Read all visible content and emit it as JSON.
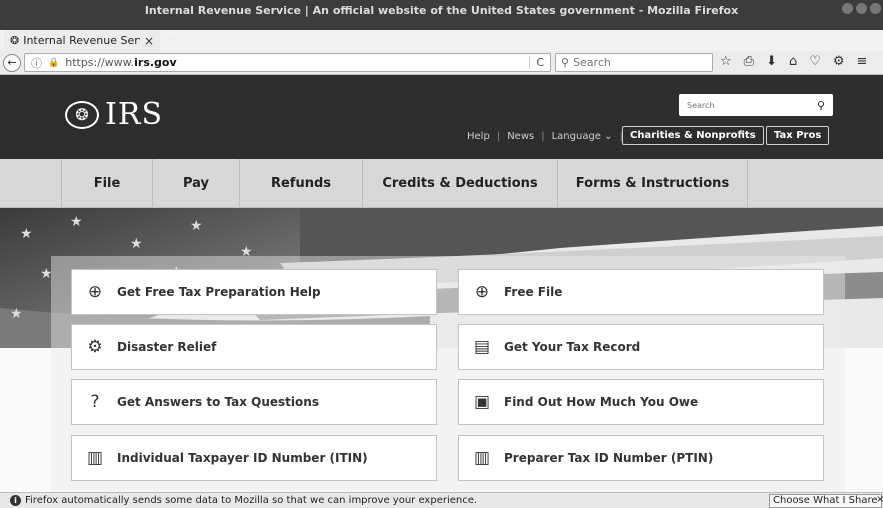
{
  "window": {
    "title": "Internal Revenue Service | An official website of the United States government - Mozilla Firefox"
  },
  "tab": {
    "label": "Internal Revenue Servic",
    "favicon": "irs-eagle-icon",
    "close": "×",
    "new_tab": "+"
  },
  "navbar": {
    "back": "←",
    "info": "ⓘ",
    "lock": "🔒",
    "url_prefix": "https://www.",
    "url_domain": "irs.gov",
    "reload": "C",
    "search_placeholder": "Search",
    "tools": [
      "☆",
      "⎙",
      "⬇",
      "⌂",
      "♡",
      "⚙",
      "≡"
    ]
  },
  "header": {
    "logo_text": "IRS",
    "search_placeholder": "Search",
    "links": [
      "Help",
      "News",
      "Language ⌄"
    ],
    "buttons": [
      "Charities & Nonprofits",
      "Tax Pros"
    ]
  },
  "mainnav": {
    "items": [
      "File",
      "Pay",
      "Refunds",
      "Credits & Deductions",
      "Forms & Instructions"
    ]
  },
  "cards": [
    {
      "label": "Get Free Tax Preparation Help",
      "icon": "lifebuoy-icon"
    },
    {
      "label": "Free File",
      "icon": "lifebuoy-icon"
    },
    {
      "label": "Disaster Relief",
      "icon": "gears-icon"
    },
    {
      "label": "Get Your Tax Record",
      "icon": "document-icon"
    },
    {
      "label": "Get Answers to Tax Questions",
      "icon": "question-circle-icon"
    },
    {
      "label": "Find Out How Much You Owe",
      "icon": "money-icon"
    },
    {
      "label": "Individual Taxpayer ID Number (ITIN)",
      "icon": "id-card-icon"
    },
    {
      "label": "Preparer Tax ID Number (PTIN)",
      "icon": "id-card-icon"
    }
  ],
  "notification": {
    "text": "Firefox automatically sends some data to Mozilla so that we can improve your experience.",
    "button": "Choose What I Share",
    "close": "×"
  },
  "colors": {
    "header_bg": "#2d2d2d",
    "nav_bg": "#d8d8d8",
    "card_bg": "#ffffff"
  }
}
